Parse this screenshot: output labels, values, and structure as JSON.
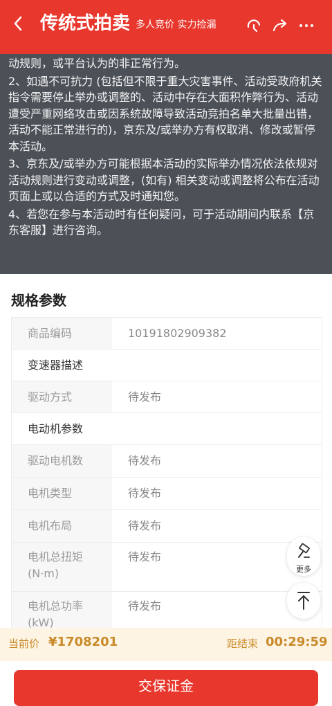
{
  "header": {
    "back_icon": "chevron-left-icon",
    "title": "传统式拍卖",
    "subtitle": "多人竞价 实力捡漏",
    "icons": [
      "headset-icon",
      "share-icon",
      "more-icon"
    ]
  },
  "notice": {
    "lines": [
      "动规则，或平台认为的非正常行为。",
      "2、如遇不可抗力 (包括但不限于重大灾害事件、活动受政府机关指令需要停止举办或调整的、活动中存在大面积作弊行为、活动遭受严重网络攻击或因系统故障导致活动竞拍名单大批量出错，活动不能正常进行的)，京东及/或举办方有权取消、修改或暂停本活动。",
      "3、京东及/或举办方可能根据本活动的实际举办情况依法依规对活动规则进行变动或调整，(如有) 相关变动或调整将公布在活动页面上或以合适的方式及时通知您。",
      "4、若您在参与本活动时有任何疑问，可于活动期间内联系【京东客服】进行咨询。"
    ]
  },
  "spec": {
    "title": "规格参数",
    "rows": [
      {
        "key": "商品编码",
        "value": "10191802909382"
      },
      {
        "section": "变速器描述"
      },
      {
        "key": "驱动方式",
        "value": "待发布"
      },
      {
        "section": "电动机参数"
      },
      {
        "key": "驱动电机数",
        "value": "待发布"
      },
      {
        "key": "电机类型",
        "value": "待发布"
      },
      {
        "key": "电机布局",
        "value": "待发布"
      },
      {
        "key": "电机总扭矩\n(N·m)",
        "value": "待发布"
      },
      {
        "key": "电机总功率\n(kW)",
        "value": "待发布"
      }
    ]
  },
  "floating": {
    "more_label": "更多",
    "more_icon": "hammer-icon",
    "top_icon": "back-to-top-icon"
  },
  "bottom": {
    "price_label": "当前价",
    "price": "¥1708201",
    "end_label": "距结束",
    "countdown": "00:29:59",
    "button_label": "交保证金"
  },
  "colors": {
    "brand_red": "#e8372c",
    "gold": "#c98a2a",
    "notice_bg": "#4c5158"
  }
}
